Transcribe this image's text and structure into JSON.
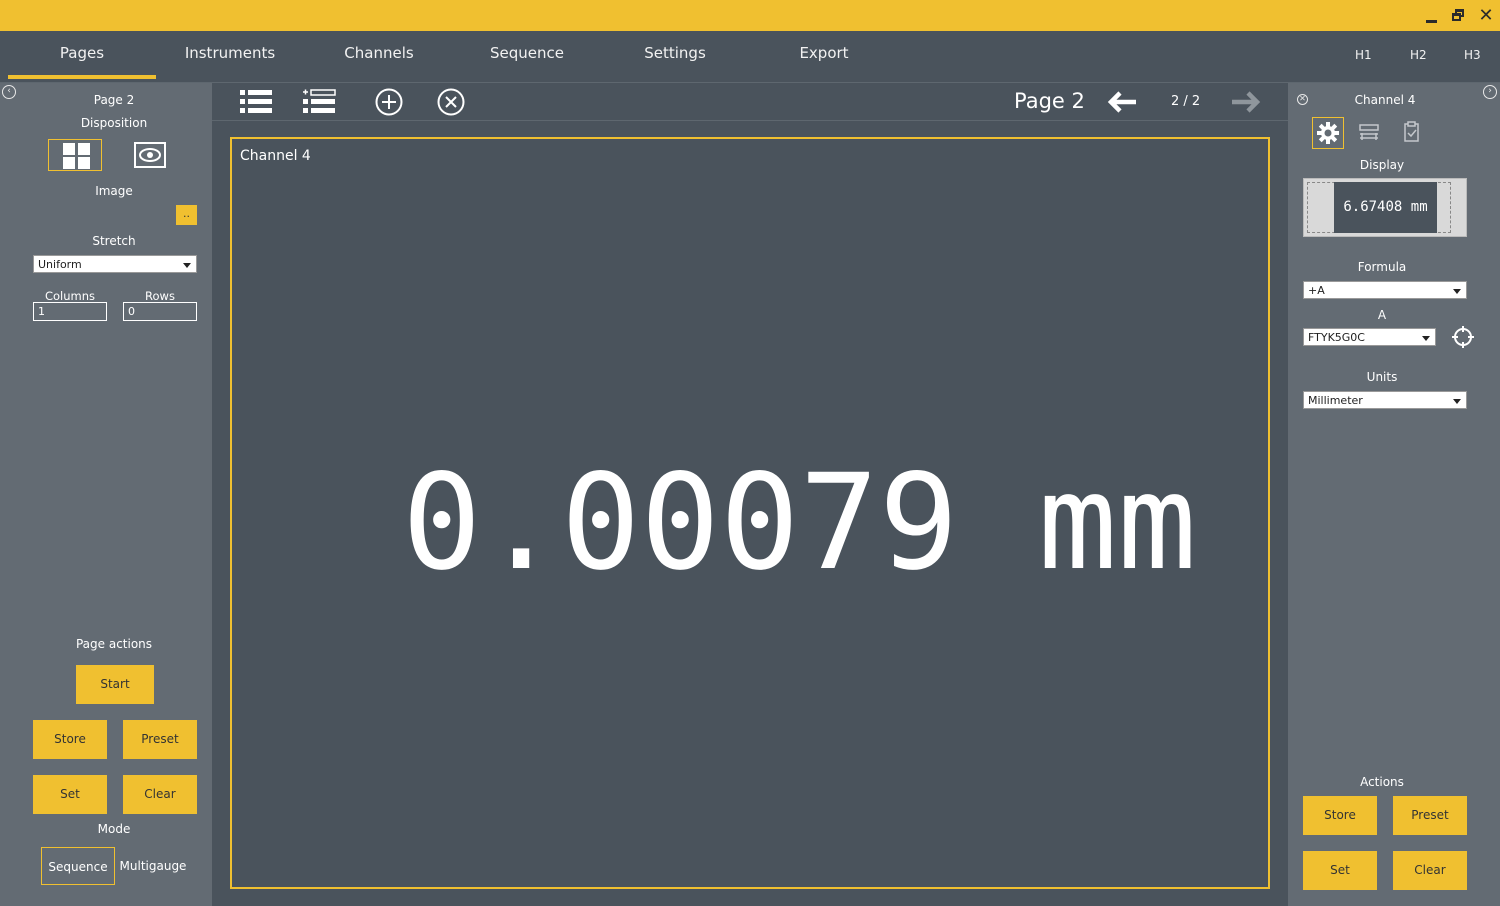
{
  "window": {
    "minimize": "minimize",
    "maximize": "maximize",
    "close": "✕"
  },
  "nav": {
    "tabs": [
      "Pages",
      "Instruments",
      "Channels",
      "Sequence",
      "Settings",
      "Export"
    ],
    "active": "Pages",
    "h_tabs": [
      "H1",
      "H2",
      "H3"
    ]
  },
  "left_panel": {
    "page_name": "Page 2",
    "disposition_label": "Disposition",
    "image_label": "Image",
    "browse_label": "..",
    "stretch_label": "Stretch",
    "stretch_value": "Uniform",
    "columns_label": "Columns",
    "columns_value": "1",
    "rows_label": "Rows",
    "rows_value": "0",
    "page_actions_label": "Page actions",
    "start_label": "Start",
    "store_label": "Store",
    "preset_label": "Preset",
    "set_label": "Set",
    "clear_label": "Clear",
    "mode_label": "Mode",
    "mode_sequence": "Sequence",
    "mode_multigauge": "Multigauge"
  },
  "toolbar": {
    "page_title": "Page 2",
    "page_counter": "2 / 2"
  },
  "channel_view": {
    "title": "Channel 4",
    "value": "0.00079 mm"
  },
  "right_panel": {
    "channel_name": "Channel 4",
    "display_label": "Display",
    "display_value": "6.67408 mm",
    "formula_label": "Formula",
    "formula_value": "+A",
    "a_label": "A",
    "a_value": "FTYK5G0C",
    "units_label": "Units",
    "units_value": "Millimeter",
    "actions_label": "Actions",
    "store_label": "Store",
    "preset_label": "Preset",
    "set_label": "Set",
    "clear_label": "Clear"
  },
  "colors": {
    "accent": "#f0c030",
    "panel": "#636b73",
    "background": "#4a535c"
  }
}
